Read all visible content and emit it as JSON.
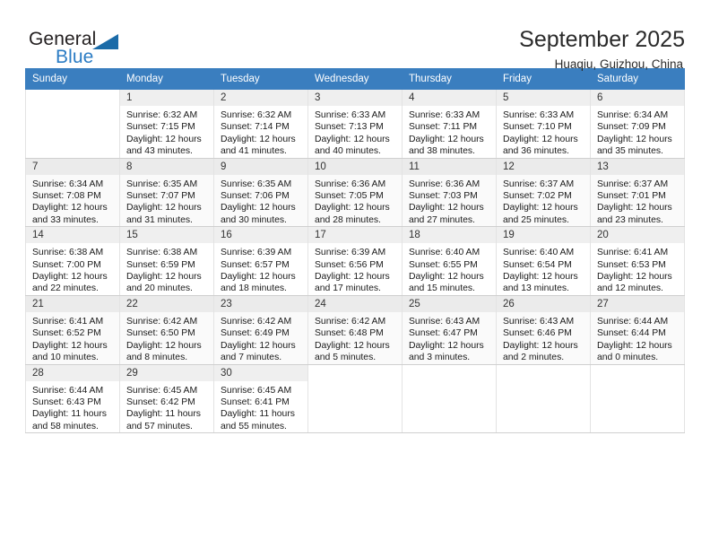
{
  "brand": {
    "name_top": "General",
    "name_bottom": "Blue",
    "accent_color": "#2b7cc4",
    "triangle_color": "#1b6ba8"
  },
  "header": {
    "title": "September 2025",
    "subtitle": "Huaqiu, Guizhou, China"
  },
  "calendar": {
    "header_background": "#3a7ebf",
    "weekday_headers": [
      "Sunday",
      "Monday",
      "Tuesday",
      "Wednesday",
      "Thursday",
      "Friday",
      "Saturday"
    ],
    "labels": {
      "sunrise_prefix": "Sunrise:",
      "sunset_prefix": "Sunset:",
      "daylight_prefix": "Daylight:"
    },
    "weeks": [
      [
        {
          "day": "",
          "sunrise": "",
          "sunset": "",
          "daylight": "",
          "empty": true
        },
        {
          "day": "1",
          "sunrise": "Sunrise: 6:32 AM",
          "sunset": "Sunset: 7:15 PM",
          "daylight": "Daylight: 12 hours and 43 minutes."
        },
        {
          "day": "2",
          "sunrise": "Sunrise: 6:32 AM",
          "sunset": "Sunset: 7:14 PM",
          "daylight": "Daylight: 12 hours and 41 minutes."
        },
        {
          "day": "3",
          "sunrise": "Sunrise: 6:33 AM",
          "sunset": "Sunset: 7:13 PM",
          "daylight": "Daylight: 12 hours and 40 minutes."
        },
        {
          "day": "4",
          "sunrise": "Sunrise: 6:33 AM",
          "sunset": "Sunset: 7:11 PM",
          "daylight": "Daylight: 12 hours and 38 minutes."
        },
        {
          "day": "5",
          "sunrise": "Sunrise: 6:33 AM",
          "sunset": "Sunset: 7:10 PM",
          "daylight": "Daylight: 12 hours and 36 minutes."
        },
        {
          "day": "6",
          "sunrise": "Sunrise: 6:34 AM",
          "sunset": "Sunset: 7:09 PM",
          "daylight": "Daylight: 12 hours and 35 minutes."
        }
      ],
      [
        {
          "day": "7",
          "sunrise": "Sunrise: 6:34 AM",
          "sunset": "Sunset: 7:08 PM",
          "daylight": "Daylight: 12 hours and 33 minutes."
        },
        {
          "day": "8",
          "sunrise": "Sunrise: 6:35 AM",
          "sunset": "Sunset: 7:07 PM",
          "daylight": "Daylight: 12 hours and 31 minutes."
        },
        {
          "day": "9",
          "sunrise": "Sunrise: 6:35 AM",
          "sunset": "Sunset: 7:06 PM",
          "daylight": "Daylight: 12 hours and 30 minutes."
        },
        {
          "day": "10",
          "sunrise": "Sunrise: 6:36 AM",
          "sunset": "Sunset: 7:05 PM",
          "daylight": "Daylight: 12 hours and 28 minutes."
        },
        {
          "day": "11",
          "sunrise": "Sunrise: 6:36 AM",
          "sunset": "Sunset: 7:03 PM",
          "daylight": "Daylight: 12 hours and 27 minutes."
        },
        {
          "day": "12",
          "sunrise": "Sunrise: 6:37 AM",
          "sunset": "Sunset: 7:02 PM",
          "daylight": "Daylight: 12 hours and 25 minutes."
        },
        {
          "day": "13",
          "sunrise": "Sunrise: 6:37 AM",
          "sunset": "Sunset: 7:01 PM",
          "daylight": "Daylight: 12 hours and 23 minutes."
        }
      ],
      [
        {
          "day": "14",
          "sunrise": "Sunrise: 6:38 AM",
          "sunset": "Sunset: 7:00 PM",
          "daylight": "Daylight: 12 hours and 22 minutes."
        },
        {
          "day": "15",
          "sunrise": "Sunrise: 6:38 AM",
          "sunset": "Sunset: 6:59 PM",
          "daylight": "Daylight: 12 hours and 20 minutes."
        },
        {
          "day": "16",
          "sunrise": "Sunrise: 6:39 AM",
          "sunset": "Sunset: 6:57 PM",
          "daylight": "Daylight: 12 hours and 18 minutes."
        },
        {
          "day": "17",
          "sunrise": "Sunrise: 6:39 AM",
          "sunset": "Sunset: 6:56 PM",
          "daylight": "Daylight: 12 hours and 17 minutes."
        },
        {
          "day": "18",
          "sunrise": "Sunrise: 6:40 AM",
          "sunset": "Sunset: 6:55 PM",
          "daylight": "Daylight: 12 hours and 15 minutes."
        },
        {
          "day": "19",
          "sunrise": "Sunrise: 6:40 AM",
          "sunset": "Sunset: 6:54 PM",
          "daylight": "Daylight: 12 hours and 13 minutes."
        },
        {
          "day": "20",
          "sunrise": "Sunrise: 6:41 AM",
          "sunset": "Sunset: 6:53 PM",
          "daylight": "Daylight: 12 hours and 12 minutes."
        }
      ],
      [
        {
          "day": "21",
          "sunrise": "Sunrise: 6:41 AM",
          "sunset": "Sunset: 6:52 PM",
          "daylight": "Daylight: 12 hours and 10 minutes."
        },
        {
          "day": "22",
          "sunrise": "Sunrise: 6:42 AM",
          "sunset": "Sunset: 6:50 PM",
          "daylight": "Daylight: 12 hours and 8 minutes."
        },
        {
          "day": "23",
          "sunrise": "Sunrise: 6:42 AM",
          "sunset": "Sunset: 6:49 PM",
          "daylight": "Daylight: 12 hours and 7 minutes."
        },
        {
          "day": "24",
          "sunrise": "Sunrise: 6:42 AM",
          "sunset": "Sunset: 6:48 PM",
          "daylight": "Daylight: 12 hours and 5 minutes."
        },
        {
          "day": "25",
          "sunrise": "Sunrise: 6:43 AM",
          "sunset": "Sunset: 6:47 PM",
          "daylight": "Daylight: 12 hours and 3 minutes."
        },
        {
          "day": "26",
          "sunrise": "Sunrise: 6:43 AM",
          "sunset": "Sunset: 6:46 PM",
          "daylight": "Daylight: 12 hours and 2 minutes."
        },
        {
          "day": "27",
          "sunrise": "Sunrise: 6:44 AM",
          "sunset": "Sunset: 6:44 PM",
          "daylight": "Daylight: 12 hours and 0 minutes."
        }
      ],
      [
        {
          "day": "28",
          "sunrise": "Sunrise: 6:44 AM",
          "sunset": "Sunset: 6:43 PM",
          "daylight": "Daylight: 11 hours and 58 minutes."
        },
        {
          "day": "29",
          "sunrise": "Sunrise: 6:45 AM",
          "sunset": "Sunset: 6:42 PM",
          "daylight": "Daylight: 11 hours and 57 minutes."
        },
        {
          "day": "30",
          "sunrise": "Sunrise: 6:45 AM",
          "sunset": "Sunset: 6:41 PM",
          "daylight": "Daylight: 11 hours and 55 minutes."
        },
        {
          "day": "",
          "sunrise": "",
          "sunset": "",
          "daylight": "",
          "empty": true
        },
        {
          "day": "",
          "sunrise": "",
          "sunset": "",
          "daylight": "",
          "empty": true
        },
        {
          "day": "",
          "sunrise": "",
          "sunset": "",
          "daylight": "",
          "empty": true
        },
        {
          "day": "",
          "sunrise": "",
          "sunset": "",
          "daylight": "",
          "empty": true
        }
      ]
    ]
  }
}
